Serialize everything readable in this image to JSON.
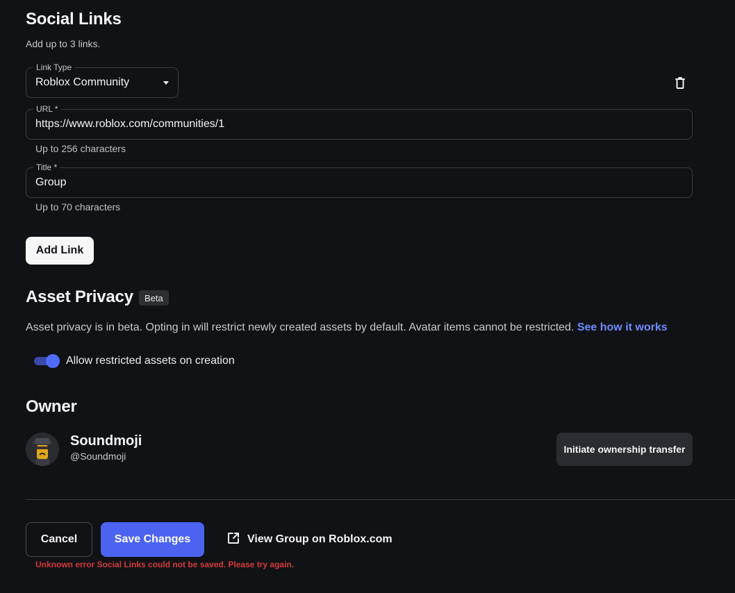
{
  "social_links": {
    "title": "Social Links",
    "subtitle": "Add up to 3 links.",
    "link_type": {
      "label": "Link Type",
      "value": "Roblox Community"
    },
    "url": {
      "label": "URL *",
      "value": "https://www.roblox.com/communities/1",
      "helper": "Up to 256 characters"
    },
    "title_field": {
      "label": "Title *",
      "value": "Group",
      "helper": "Up to 70 characters"
    },
    "add_link_label": "Add Link",
    "delete_icon": "trash-icon"
  },
  "asset_privacy": {
    "title": "Asset Privacy",
    "badge": "Beta",
    "description": "Asset privacy is in beta. Opting in will restrict newly created assets by default. Avatar items cannot be restricted.",
    "link_text": "See how it works",
    "toggle_label": "Allow restricted assets on creation",
    "toggle_on": true
  },
  "owner": {
    "title": "Owner",
    "name": "Soundmoji",
    "handle": "@Soundmoji",
    "transfer_label": "Initiate ownership transfer"
  },
  "footer": {
    "cancel_label": "Cancel",
    "save_label": "Save Changes",
    "view_label": "View Group on Roblox.com",
    "view_icon": "external-link-icon",
    "error": "Unknown error Social Links could not be saved. Please try again."
  },
  "colors": {
    "background": "#111216",
    "primary": "#4b63f0",
    "link": "#6c8cff",
    "error": "#d63a3a"
  }
}
